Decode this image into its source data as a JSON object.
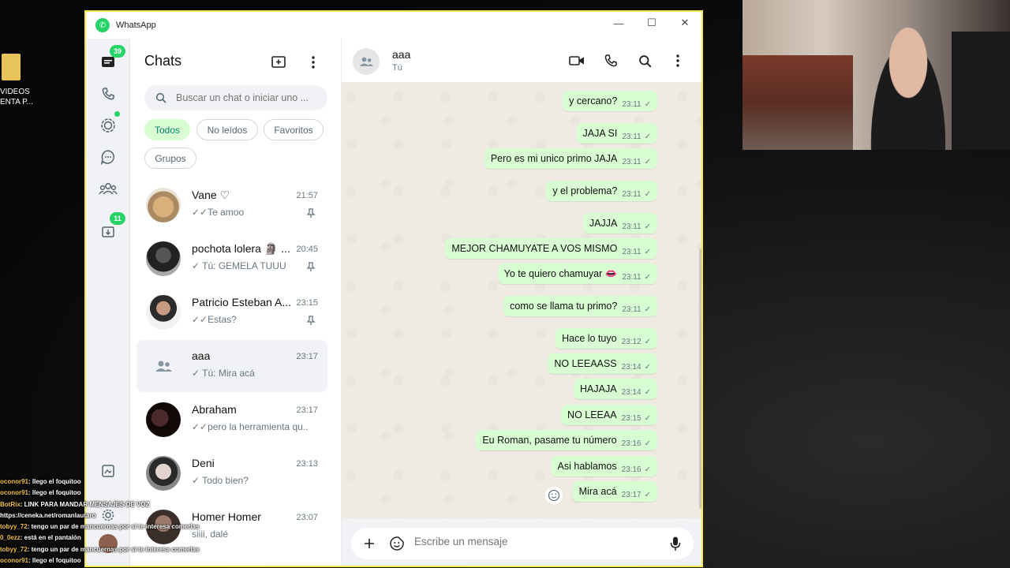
{
  "desktop": {
    "icon_label": "VIDEOS\nENTA P..."
  },
  "window": {
    "title": "WhatsApp",
    "controls": {
      "minimize": "—",
      "maximize": "☐",
      "close": "✕"
    }
  },
  "rail": {
    "chats_badge": "39",
    "archive_badge": "11",
    "icons": [
      "chats-icon",
      "calls-icon",
      "status-icon",
      "channels-icon",
      "communities-icon",
      "archived-icon",
      "starred-icon",
      "profile-icon"
    ]
  },
  "chat_list": {
    "header": "Chats",
    "search_placeholder": "Buscar un chat o iniciar uno ...",
    "filters": [
      "Todos",
      "No leídos",
      "Favoritos",
      "Grupos"
    ],
    "active_filter": "Todos",
    "chats": [
      {
        "name": "Vane ♡",
        "time": "21:57",
        "preview": "✓✓Te amoo",
        "pinned": true
      },
      {
        "name": "pochota lolera 🗿 ...",
        "time": "20:45",
        "preview": "✓ Tú: GEMELA TUUU",
        "pinned": true
      },
      {
        "name": "Patricio Esteban A...",
        "time": "23:15",
        "preview": "✓✓Estas?",
        "pinned": true
      },
      {
        "name": "aaa",
        "time": "23:17",
        "preview": "✓ Tú: Mira acá",
        "pinned": false
      },
      {
        "name": "Abraham",
        "time": "23:17",
        "preview": "✓✓pero la herramienta qu...",
        "pinned": false
      },
      {
        "name": "Deni",
        "time": "23:13",
        "preview": "✓ Todo bien?",
        "pinned": false
      },
      {
        "name": "Homer Homer",
        "time": "23:07",
        "preview": "siiii, dalé",
        "pinned": false
      }
    ]
  },
  "conversation": {
    "name": "aaa",
    "subtitle": "Tú",
    "messages": [
      {
        "text": "y cercano?",
        "time": "23:11"
      },
      {
        "text": "JAJA SI",
        "time": "23:11"
      },
      {
        "text": "Pero es mi unico primo JAJA",
        "time": "23:11"
      },
      {
        "text": "y el problema?",
        "time": "23:11"
      },
      {
        "text": "JAJJA",
        "time": "23:11"
      },
      {
        "text": "MEJOR CHAMUYATE A VOS MISMO",
        "time": "23:11"
      },
      {
        "text": "Yo te quiero chamuyar 👄",
        "time": "23:11"
      },
      {
        "text": "como se llama tu primo?",
        "time": "23:11"
      },
      {
        "text": "Hace lo tuyo",
        "time": "23:12"
      },
      {
        "text": "NO LEEAASS",
        "time": "23:14"
      },
      {
        "text": "HAJAJA",
        "time": "23:14"
      },
      {
        "text": "NO LEEAA",
        "time": "23:15"
      },
      {
        "text": "Eu Roman, pasame tu número",
        "time": "23:16"
      },
      {
        "text": "Asi hablamos",
        "time": "23:16"
      },
      {
        "text": "Mira acá",
        "time": "23:17"
      }
    ],
    "composer_placeholder": "Escribe un mensaje"
  },
  "stream_chat": [
    {
      "user": "oconor91",
      "text": ": llego el foquitoo"
    },
    {
      "user": "oconor91",
      "text": ": llego el foquitoo"
    },
    {
      "user": "BotRix",
      "text": ": LINK PARA MANDAR MENSAJES DE VOZ"
    },
    {
      "user": "",
      "text": "https://ceneka.net/romanlautaro"
    },
    {
      "user": "tobyy_72",
      "text": ": tengo un par de mancuernas por si te interesa comerlas"
    },
    {
      "user": "0_0ezz",
      "text": ": está en el pantalón"
    },
    {
      "user": "tobyy_72",
      "text": ": tengo un par de mancuernas por si te interesa comerlas"
    },
    {
      "user": "oconor91",
      "text": ": llego el foquitoo"
    }
  ],
  "colors": {
    "accent": "#25d366",
    "bubble_out": "#d9fdd3",
    "chat_bg": "#efeae2",
    "window_border": "#f2e94a"
  }
}
